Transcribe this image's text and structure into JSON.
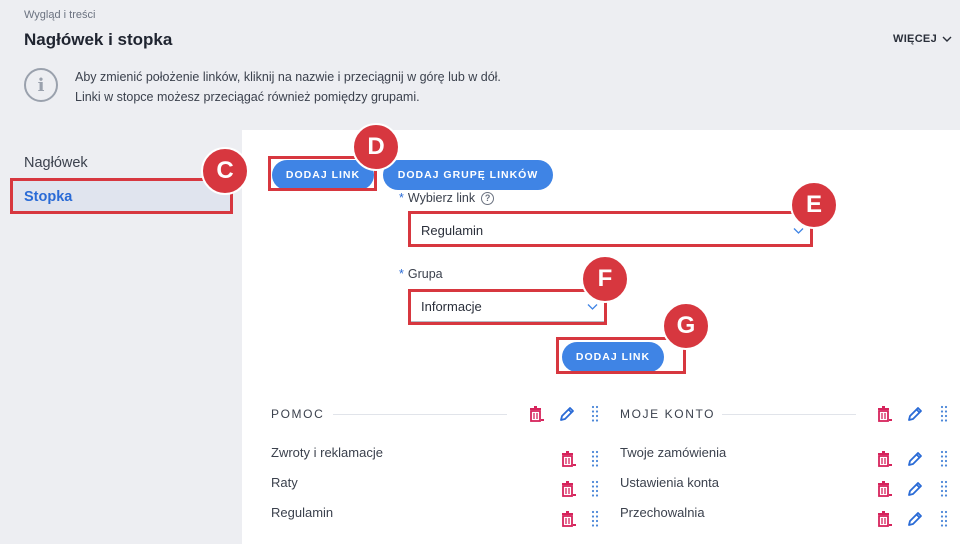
{
  "header": {
    "breadcrumb": "Wygląd i treści",
    "title": "Nagłówek i stopka",
    "more_label": "WIĘCEJ"
  },
  "info": {
    "line1": "Aby zmienić położenie linków, kliknij na nazwie i przeciągnij w górę lub w dół.",
    "line2": "Linki w stopce możesz przeciągać również pomiędzy grupami."
  },
  "sidebar": {
    "items": [
      {
        "label": "Nagłówek",
        "active": false
      },
      {
        "label": "Stopka",
        "active": true
      }
    ]
  },
  "form": {
    "add_link_label": "DODAJ LINK",
    "add_group_label": "DODAJ GRUPĘ LINKÓW",
    "link_label": "Wybierz link",
    "link_value": "Regulamin",
    "group_label": "Grupa",
    "group_value": "Informacje",
    "required_mark": "*",
    "help_mark": "?",
    "submit_label": "DODAJ LINK"
  },
  "annotations": {
    "C": "C",
    "D": "D",
    "E": "E",
    "F": "F",
    "G": "G",
    "color": "#d7373f"
  },
  "groups": [
    {
      "title": "POMOC",
      "links": [
        "Zwroty i reklamacje",
        "Raty",
        "Regulamin"
      ]
    },
    {
      "title": "MOJE KONTO",
      "links": [
        "Twoje zamówienia",
        "Ustawienia konta",
        "Przechowalnia"
      ]
    }
  ],
  "colors": {
    "accent": "#3f84e5",
    "delete": "#d6245c",
    "edit": "#2a6bd6"
  }
}
